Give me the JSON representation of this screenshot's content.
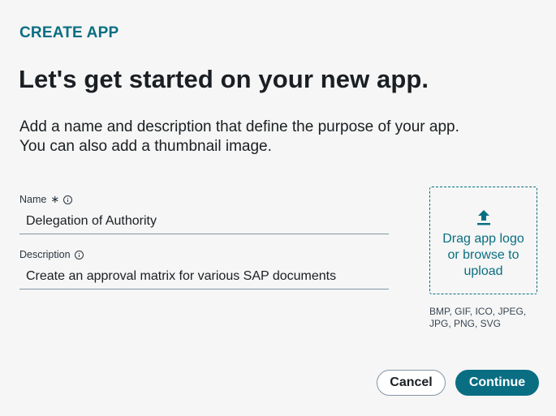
{
  "header": {
    "eyebrow": "CREATE APP",
    "title": "Let's get started on your new app.",
    "description_line1": "Add a name and description that define the purpose of your app.",
    "description_line2": "You can also add a thumbnail image."
  },
  "form": {
    "name": {
      "label": "Name",
      "required_marker": "∗",
      "value": "Delegation of Authority"
    },
    "description": {
      "label": "Description",
      "value": "Create an approval matrix for various SAP documents"
    }
  },
  "upload": {
    "text_line1": "Drag app logo",
    "text_line2": "or browse to",
    "text_line3": "upload",
    "formats_line1": "BMP, GIF, ICO, JPEG,",
    "formats_line2": "JPG, PNG, SVG",
    "icon": "upload-icon"
  },
  "actions": {
    "cancel_label": "Cancel",
    "continue_label": "Continue"
  },
  "colors": {
    "accent": "#0a6e83",
    "background": "#f5f6f5"
  }
}
